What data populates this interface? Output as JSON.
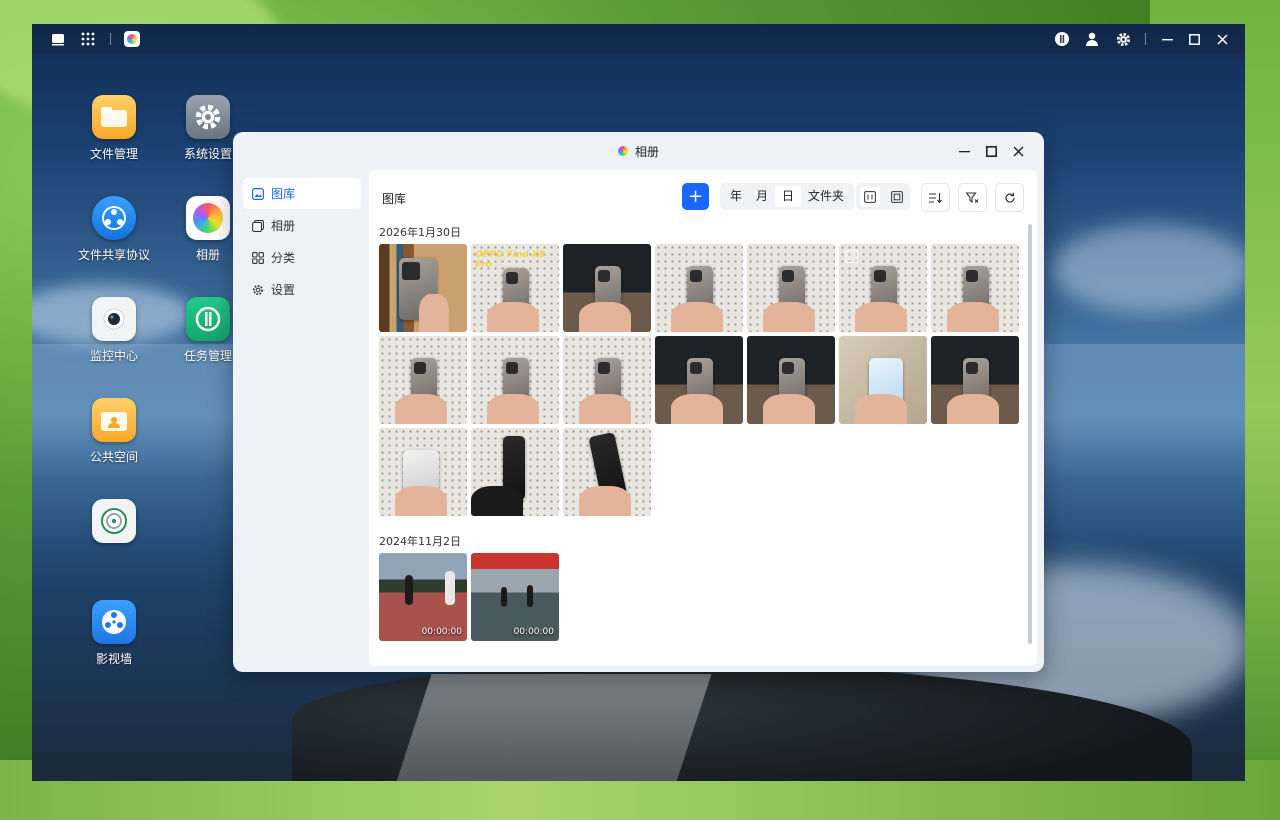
{
  "desktop": {
    "icons": [
      {
        "label": "文件管理",
        "color": "#fbb836"
      },
      {
        "label": "系统设置",
        "color": "#7e8896"
      },
      {
        "label": "文件共享协议",
        "color": "#1e8bea"
      },
      {
        "label": "相册",
        "color": "#ffffff"
      },
      {
        "label": "监控中心",
        "color": "#f1f3f5"
      },
      {
        "label": "任务管理",
        "color": "#19b97a"
      },
      {
        "label": "公共空间",
        "color": "#fbb836"
      },
      {
        "label": "",
        "color": "#f1f3f5"
      },
      {
        "label": "影视墙",
        "color": "#2a8cf2"
      }
    ]
  },
  "window": {
    "title": "相册",
    "sidebar": [
      {
        "label": "图库",
        "icon": "gallery-icon",
        "active": true
      },
      {
        "label": "相册",
        "icon": "album-icon",
        "active": false
      },
      {
        "label": "分类",
        "icon": "category-icon",
        "active": false
      },
      {
        "label": "设置",
        "icon": "gear-icon",
        "active": false
      }
    ],
    "content_title": "图库",
    "add_label": "+",
    "segments": [
      "年",
      "月",
      "日",
      "文件夹"
    ],
    "active_segment": "日",
    "groups": [
      {
        "date": "2026年1月30日",
        "count": 17,
        "first_caption": "OPPO Find X9 Pro"
      },
      {
        "date": "2024年11月2日",
        "count": 2,
        "durations": [
          "00:00:00",
          "00:00:00"
        ]
      }
    ]
  },
  "colors": {
    "accent": "#1a66ff"
  }
}
